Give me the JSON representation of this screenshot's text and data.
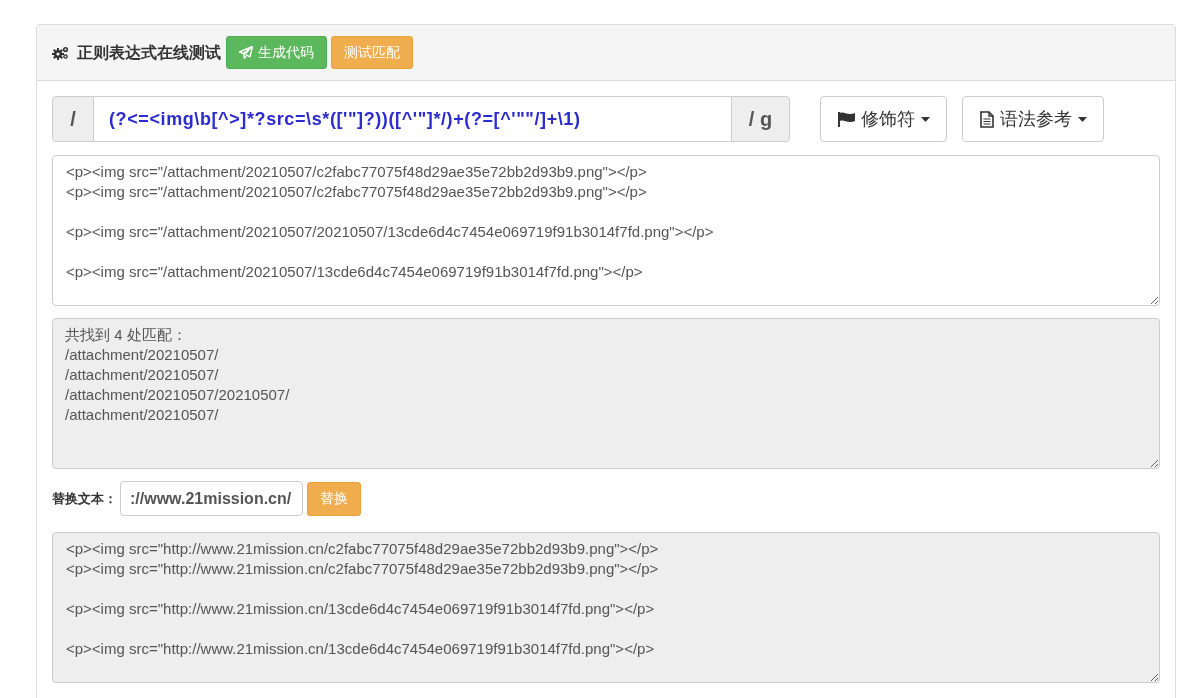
{
  "header": {
    "title": "正则表达式在线测试",
    "buttons": [
      {
        "label": "生成代码",
        "kind": "success"
      },
      {
        "label": "测试匹配",
        "kind": "warning"
      }
    ]
  },
  "regex": {
    "prefix": "/",
    "pattern": "(?<=<img\\b[^>]*?src=\\s*(['\"]?))([^'\"]*/)+(?=[^'\"\"/]+\\1)",
    "flags": "/ g"
  },
  "menus": [
    {
      "label": "修饰符"
    },
    {
      "label": "语法参考"
    }
  ],
  "test_text": {
    "text": "<p><img src=\"/attachment/20210507/c2fabc77075f48d29ae35e72bb2d93b9.png\"></p>\n<p><img src=\"/attachment/20210507/c2fabc77075f48d29ae35e72bb2d93b9.png\"></p>\n\n<p><img src=\"/attachment/20210507/20210507/13cde6d4c7454e069719f91b3014f7fd.png\"></p>\n\n<p><img src=\"/attachment/20210507/13cde6d4c7454e069719f91b3014f7fd.png\"></p>"
  },
  "match_result": {
    "text": "共找到 4 处匹配：\n/attachment/20210507/\n/attachment/20210507/\n/attachment/20210507/20210507/\n/attachment/20210507/"
  },
  "replace": {
    "label": "替换文本：",
    "value": "://www.21mission.cn/",
    "button": "替换"
  },
  "replace_result": {
    "text": "<p><img src=\"http://www.21mission.cn/c2fabc77075f48d29ae35e72bb2d93b9.png\"></p>\n<p><img src=\"http://www.21mission.cn/c2fabc77075f48d29ae35e72bb2d93b9.png\"></p>\n\n<p><img src=\"http://www.21mission.cn/13cde6d4c7454e069719f91b3014f7fd.png\"></p>\n\n<p><img src=\"http://www.21mission.cn/13cde6d4c7454e069719f91b3014f7fd.png\"></p>"
  }
}
